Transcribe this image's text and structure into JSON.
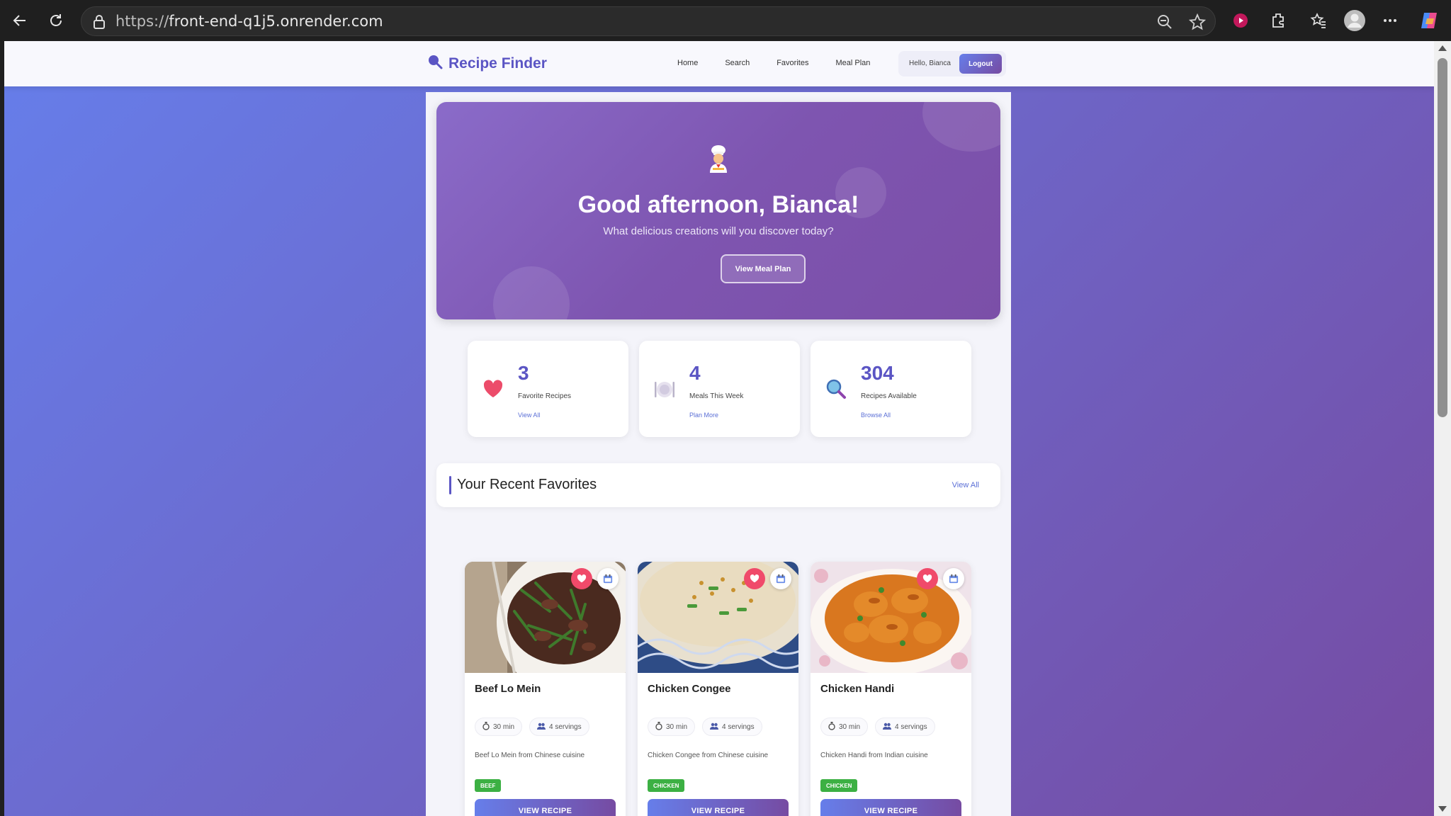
{
  "browser": {
    "url_scheme": "https://",
    "url_host": "front-end-q1j5.onrender.com"
  },
  "navbar": {
    "brand": "Recipe Finder",
    "links": [
      "Home",
      "Search",
      "Favorites",
      "Meal Plan"
    ],
    "greeting": "Hello, Bianca",
    "logout": "Logout"
  },
  "hero": {
    "title": "Good afternoon, Bianca!",
    "subtitle": "What delicious creations will you discover today?",
    "button": "View Meal Plan"
  },
  "stats": [
    {
      "value": "3",
      "label": "Favorite Recipes",
      "link": "View All",
      "icon": "heart-icon"
    },
    {
      "value": "4",
      "label": "Meals This Week",
      "link": "Plan More",
      "icon": "plate-icon"
    },
    {
      "value": "304",
      "label": "Recipes Available",
      "link": "Browse All",
      "icon": "magnifier-icon"
    }
  ],
  "favorites": {
    "title": "Your Recent Favorites",
    "view_all": "View All",
    "recipes": [
      {
        "title": "Beef Lo Mein",
        "time": "30 min",
        "servings": "4 servings",
        "description": "Beef Lo Mein from Chinese cuisine",
        "tag": "BEEF",
        "button": "VIEW RECIPE"
      },
      {
        "title": "Chicken Congee",
        "time": "30 min",
        "servings": "4 servings",
        "description": "Chicken Congee from Chinese cuisine",
        "tag": "CHICKEN",
        "button": "VIEW RECIPE"
      },
      {
        "title": "Chicken Handi",
        "time": "30 min",
        "servings": "4 servings",
        "description": "Chicken Handi from Indian cuisine",
        "tag": "CHICKEN",
        "button": "VIEW RECIPE"
      }
    ]
  },
  "colors": {
    "background_start": "#667eea",
    "background_end": "#764ba2",
    "brand": "#5b55c4",
    "heart": "#f04a6a",
    "tag_green": "#3cb043"
  }
}
